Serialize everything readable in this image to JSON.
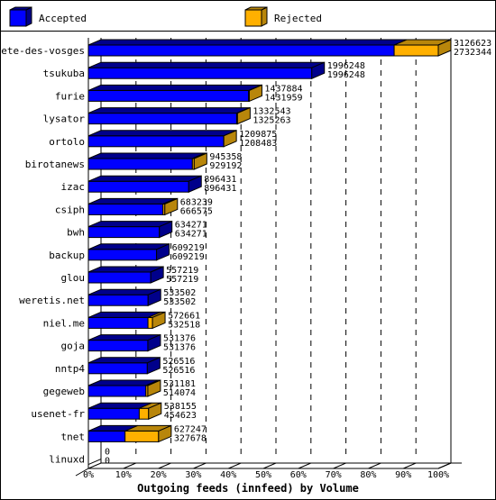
{
  "chart_data": {
    "type": "bar",
    "orientation": "horizontal",
    "stacked": true,
    "style": "3d",
    "title": "",
    "xlabel": "Outgoing feeds (innfeed) by Volume",
    "ylabel": "",
    "xlim": [
      0,
      100
    ],
    "x_unit": "%",
    "x_ticks": [
      "0%",
      "10%",
      "20%",
      "30%",
      "40%",
      "50%",
      "60%",
      "70%",
      "80%",
      "90%",
      "100%"
    ],
    "grid": true,
    "legend_position": "top",
    "legend": [
      {
        "name": "Accepted",
        "color": "#0000ff"
      },
      {
        "name": "Rejected",
        "color": "#ffb000"
      }
    ],
    "max_total": 3126623,
    "categories": [
      "bete-des-vosges",
      "tsukuba",
      "furie",
      "lysator",
      "ortolo",
      "birotanews",
      "izac",
      "csiph",
      "bwh",
      "backup",
      "glou",
      "weretis.net",
      "niel.me",
      "goja",
      "nntp4",
      "gegeweb",
      "usenet-fr",
      "tnet",
      "linuxd"
    ],
    "totals": [
      3126623,
      1996248,
      1437884,
      1332543,
      1209875,
      945358,
      896431,
      683239,
      634271,
      609219,
      557219,
      533502,
      572661,
      531376,
      526516,
      531181,
      538155,
      627247,
      0
    ],
    "accepted": [
      2732344,
      1996248,
      1431959,
      1325263,
      1208483,
      929192,
      896431,
      666575,
      634271,
      609219,
      557219,
      533502,
      532518,
      531376,
      526516,
      514074,
      454623,
      327678,
      0
    ],
    "series": [
      {
        "name": "Accepted",
        "values": [
          2732344,
          1996248,
          1431959,
          1325263,
          1208483,
          929192,
          896431,
          666575,
          634271,
          609219,
          557219,
          533502,
          532518,
          531376,
          526516,
          514074,
          454623,
          327678,
          0
        ]
      },
      {
        "name": "Rejected",
        "values": [
          394279,
          0,
          5925,
          7280,
          1392,
          16166,
          0,
          16664,
          0,
          0,
          0,
          0,
          40143,
          0,
          0,
          17107,
          83532,
          299569,
          0
        ]
      }
    ]
  }
}
